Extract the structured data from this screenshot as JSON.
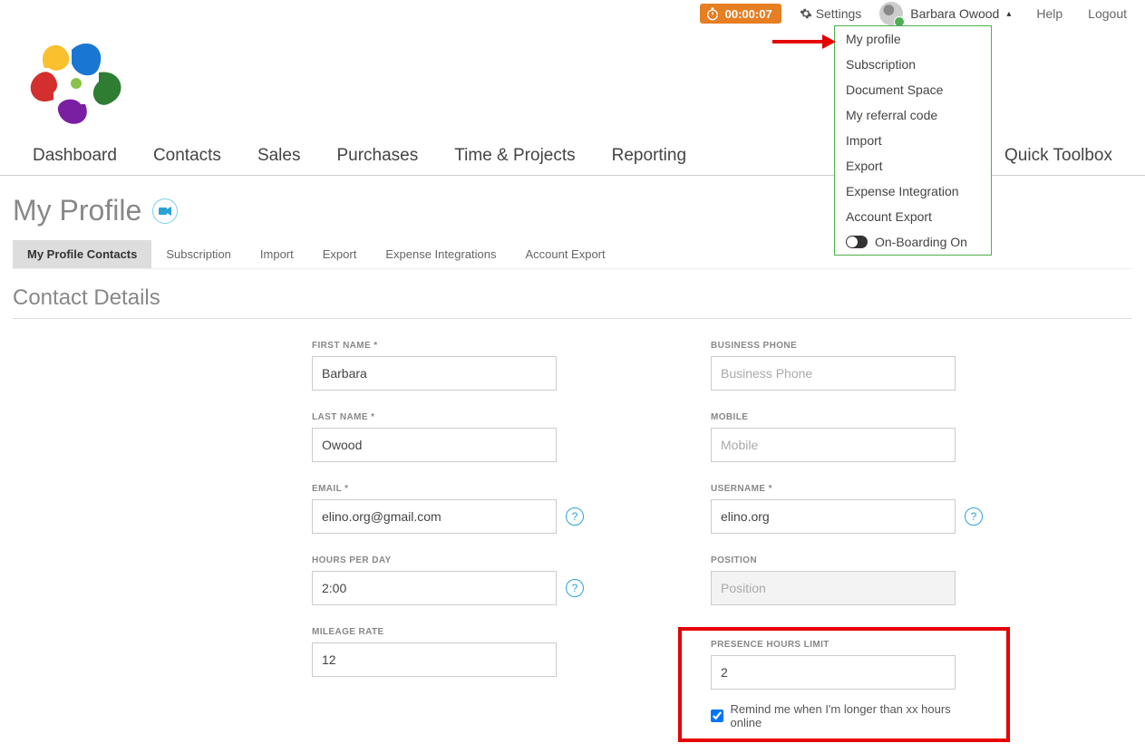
{
  "topbar": {
    "timer": "00:00:07",
    "settings": "Settings",
    "user_name": "Barbara Owood",
    "help": "Help",
    "logout": "Logout"
  },
  "user_menu": {
    "items": [
      "My profile",
      "Subscription",
      "Document Space",
      "My referral code",
      "Import",
      "Export",
      "Expense Integration",
      "Account Export"
    ],
    "toggle_label": "On-Boarding On"
  },
  "main_nav": {
    "items": [
      "Dashboard",
      "Contacts",
      "Sales",
      "Purchases",
      "Time & Projects",
      "Reporting"
    ],
    "right": "Quick Toolbox"
  },
  "page": {
    "title": "My Profile",
    "section_title": "Contact Details"
  },
  "subtabs": [
    "My Profile Contacts",
    "Subscription",
    "Import",
    "Export",
    "Expense Integrations",
    "Account Export"
  ],
  "form": {
    "first_name": {
      "label": "FIRST NAME *",
      "value": "Barbara"
    },
    "business_phone": {
      "label": "BUSINESS PHONE",
      "placeholder": "Business Phone",
      "value": ""
    },
    "last_name": {
      "label": "LAST NAME *",
      "value": "Owood"
    },
    "mobile": {
      "label": "MOBILE",
      "placeholder": "Mobile",
      "value": ""
    },
    "email": {
      "label": "EMAIL *",
      "value": "elino.org@gmail.com"
    },
    "username": {
      "label": "USERNAME *",
      "value": "elino.org"
    },
    "hours_per_day": {
      "label": "HOURS PER DAY",
      "value": "2:00"
    },
    "position": {
      "label": "POSITION",
      "placeholder": "Position",
      "value": ""
    },
    "mileage_rate": {
      "label": "MILEAGE RATE",
      "value": "12"
    },
    "presence_limit": {
      "label": "PRESENCE HOURS LIMIT",
      "value": "2"
    },
    "remind_label": "Remind me when I'm longer than xx hours online",
    "remind_checked": true
  }
}
